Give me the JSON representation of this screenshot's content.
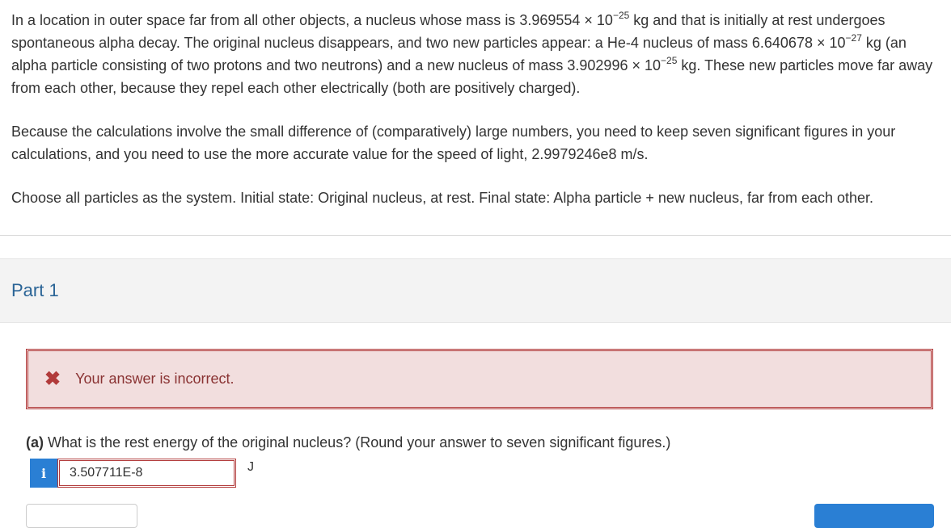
{
  "problem": {
    "p1_a": "In a location in outer space far from all other objects, a nucleus whose mass is 3.969554 × 10",
    "p1_exp1": "−25",
    "p1_b": " kg and that is initially at rest undergoes spontaneous alpha decay. The original nucleus disappears, and two new particles appear: a He-4 nucleus of mass 6.640678 × 10",
    "p1_exp2": "−27",
    "p1_c": " kg (an alpha particle consisting of two protons and two neutrons) and a new nucleus of mass 3.902996 × 10",
    "p1_exp3": "−25",
    "p1_d": " kg. These new particles move far away from each other, because they repel each other electrically (both are positively charged).",
    "p2": "Because the calculations involve the small difference of (comparatively) large numbers, you need to keep seven significant figures in your calculations, and you need to use the more accurate value for the speed of light, 2.9979246e8 m/s.",
    "p3": "Choose all particles as the system. Initial state: Original nucleus, at rest. Final state: Alpha particle + new nucleus, far from each other."
  },
  "part": {
    "title": "Part 1"
  },
  "feedback": {
    "icon": "close-icon",
    "symbol": "✖",
    "message": "Your answer is incorrect."
  },
  "question": {
    "label": "(a)",
    "text": " What is the rest energy of the original nucleus? (Round your answer to seven significant figures.)"
  },
  "answer": {
    "info_symbol": "i",
    "value": "3.507711E-8",
    "unit": "J"
  },
  "colors": {
    "error": "#b13a3a",
    "error_bg": "#f2dede",
    "accent": "#2a7fd4",
    "part_title": "#2a6496"
  }
}
